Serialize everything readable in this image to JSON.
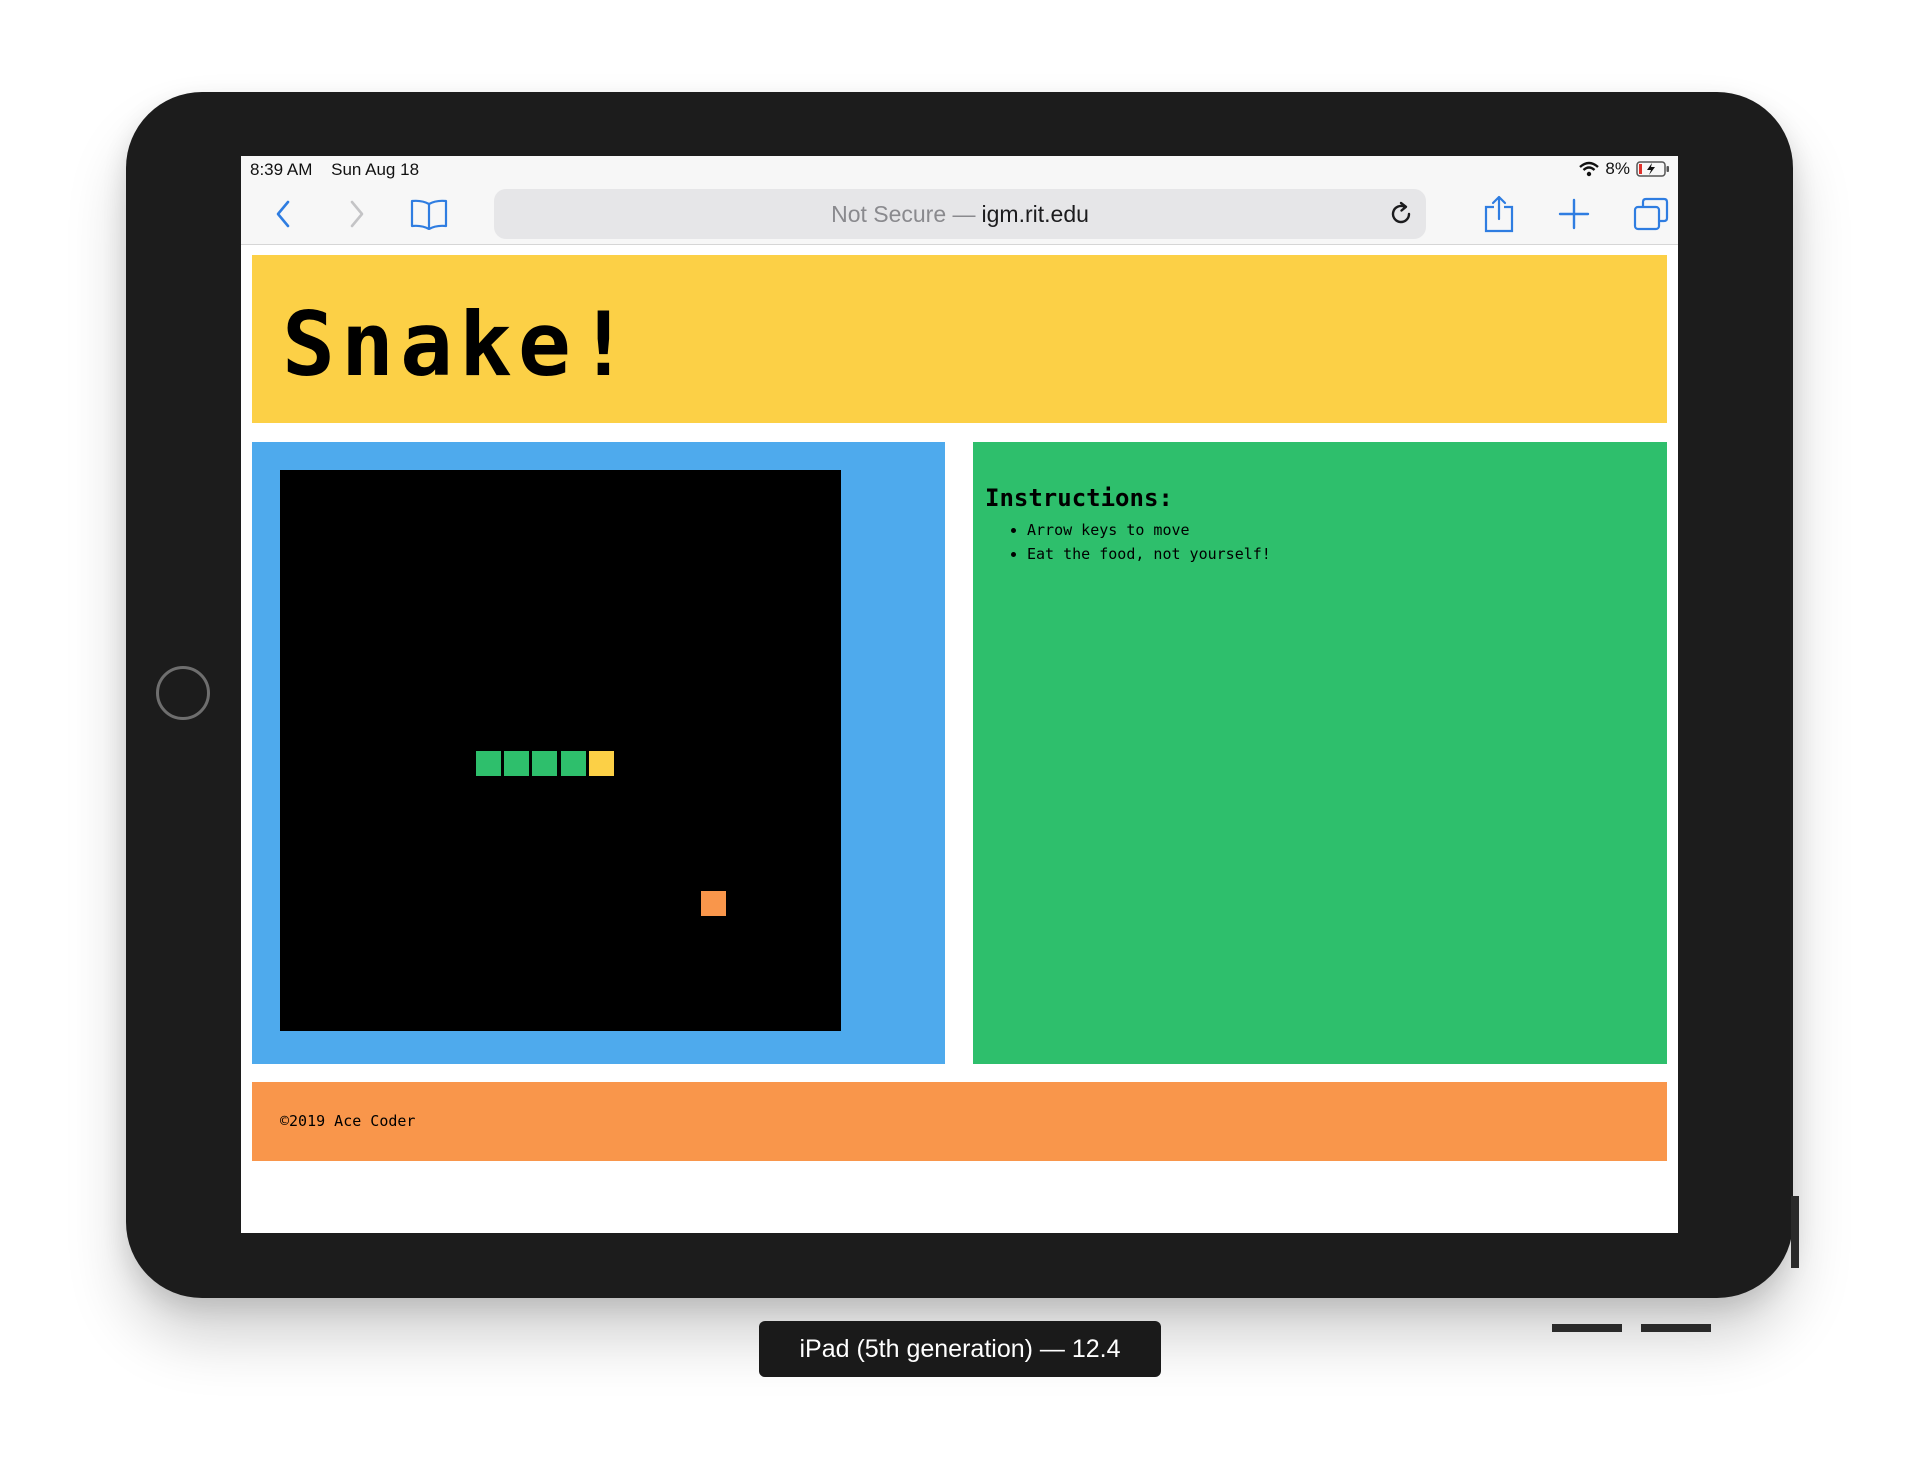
{
  "status_bar": {
    "time": "8:39 AM",
    "date": "Sun Aug 18",
    "battery_percent": "8%"
  },
  "browser": {
    "url_prefix": "Not Secure —",
    "url_domain": "igm.rit.edu",
    "icons": [
      "back-icon",
      "forward-icon",
      "bookmarks-icon",
      "reload-icon",
      "share-icon",
      "new-tab-icon",
      "tabs-icon"
    ]
  },
  "page": {
    "title": "Snake!",
    "instructions": {
      "heading": "Instructions:",
      "items": [
        "Arrow keys to move",
        "Eat the food, not yourself!"
      ]
    },
    "footer": "©2019 Ace Coder"
  },
  "game": {
    "grid_size": 20,
    "snake_body": [
      [
        7,
        10
      ],
      [
        8,
        10
      ],
      [
        9,
        10
      ],
      [
        10,
        10
      ]
    ],
    "snake_head": [
      11,
      10
    ],
    "food": [
      15,
      15
    ],
    "colors": {
      "body": "#2ebf6c",
      "head": "#fcd046",
      "food": "#f9964b",
      "board": "#000000"
    }
  },
  "colors": {
    "header": "#fcd046",
    "game_panel": "#4eaaed",
    "instructions_panel": "#2ebf6c",
    "footer": "#f9964b",
    "browser_accent": "#2f7de1"
  },
  "device_caption": "iPad (5th generation) — 12.4"
}
